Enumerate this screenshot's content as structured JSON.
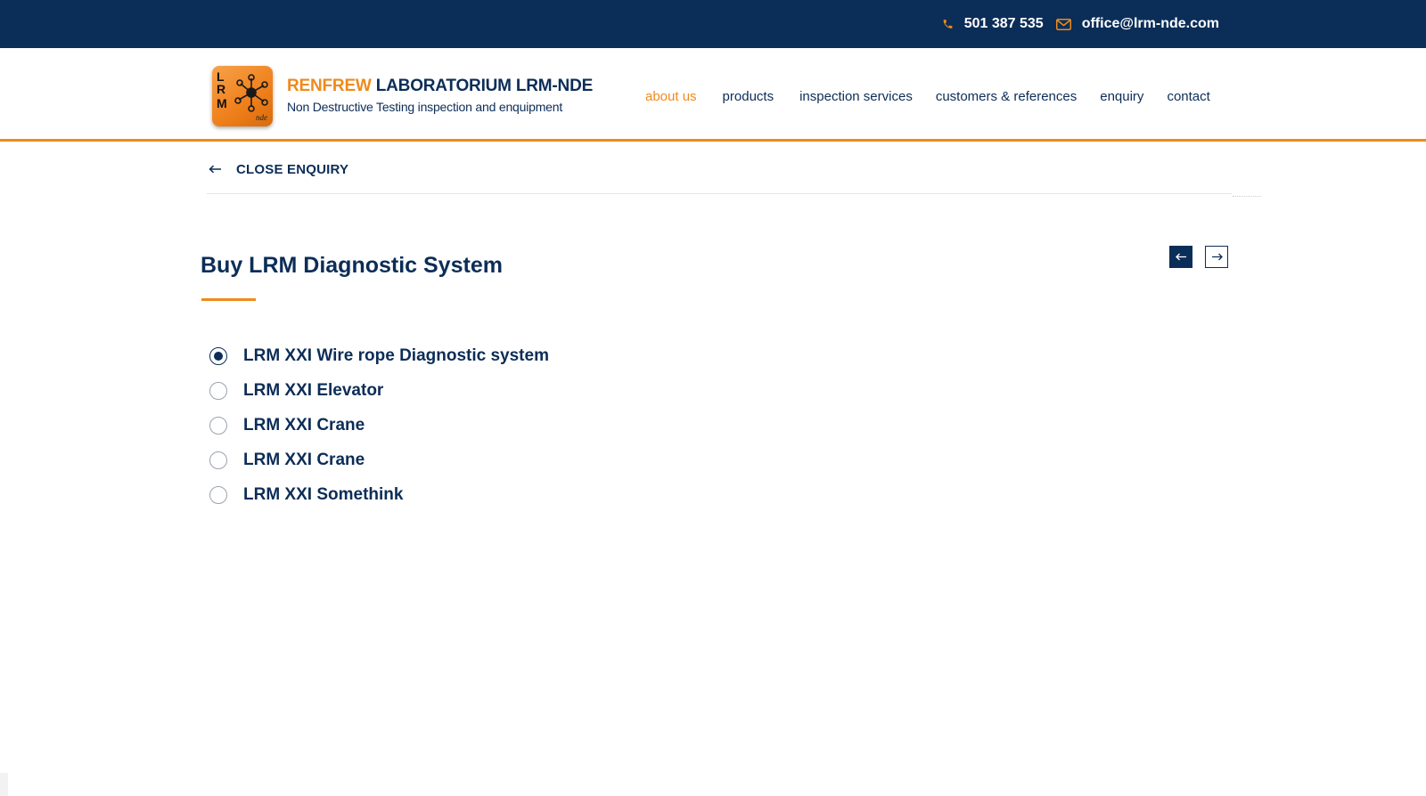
{
  "topbar": {
    "phone": "501 387 535",
    "email": "office@lrm-nde.com",
    "phone_icon": "phone-icon",
    "email_icon": "envelope-icon"
  },
  "brand": {
    "logo_letters_top": "L",
    "logo_letters_mid": "R",
    "logo_letters_bottom": "M",
    "logo_sub": "nde",
    "name_orange": "RENFREW",
    "name_blue": "LABORATORIUM LRM-NDE",
    "tagline": "Non Destructive Testing inspection and enquipment"
  },
  "nav": {
    "items": [
      {
        "label": "about us",
        "active": true
      },
      {
        "label": "products",
        "active": false
      },
      {
        "label": "inspection services",
        "active": false
      },
      {
        "label": "customers & references",
        "active": false
      },
      {
        "label": "enquiry",
        "active": false
      },
      {
        "label": "contact",
        "active": false
      }
    ]
  },
  "enquiry": {
    "close_label": "CLOSE ENQUIRY",
    "close_icon": "arrow-left-icon",
    "title": "Buy LRM Diagnostic System",
    "prev_icon": "arrow-left-icon",
    "next_icon": "arrow-right-icon",
    "options": [
      {
        "label": "LRM XXI Wire rope Diagnostic system",
        "selected": true
      },
      {
        "label": "LRM XXI Elevator",
        "selected": false
      },
      {
        "label": "LRM XXI Crane",
        "selected": false
      },
      {
        "label": "LRM XXI Crane",
        "selected": false
      },
      {
        "label": "LRM XXI Somethink",
        "selected": false
      }
    ]
  },
  "colors": {
    "navy": "#0b2e58",
    "orange": "#ef8a1b",
    "text": "#0c2d57"
  }
}
